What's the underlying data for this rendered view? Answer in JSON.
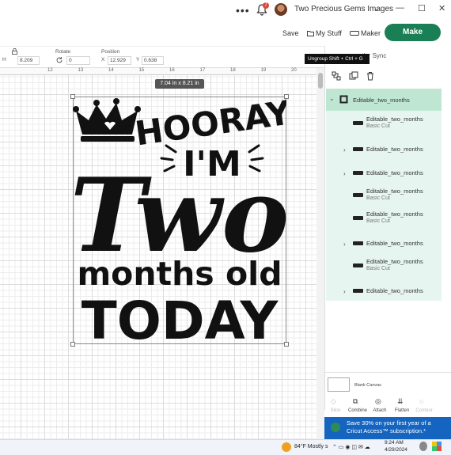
{
  "titlebar": {
    "menu_dots": "•••",
    "notif_count": "7",
    "project_name": "Two Precious Gems Images",
    "minimize": "—",
    "maximize": "☐",
    "close": "✕"
  },
  "toolbar": {
    "save_label": "Save",
    "mystuff_label": "My Stuff",
    "maker_label": "Maker",
    "make_label": "Make"
  },
  "editbar": {
    "h_label": "H",
    "h_value": "8.209",
    "rotate_label": "Rotate",
    "rotate_value": "0",
    "position_label": "Position",
    "x_label": "X",
    "x_value": "12.929",
    "y_label": "Y",
    "y_value": "0.638"
  },
  "ruler": {
    "ticks": [
      "12",
      "13",
      "14",
      "15",
      "16",
      "17",
      "18",
      "19",
      "20"
    ]
  },
  "canvas": {
    "dimension_tip": "7.04  in x 8.21  in",
    "design_lines": [
      "HOORAY",
      "I'M",
      "Two",
      "months old",
      "TODAY"
    ]
  },
  "panel": {
    "tooltip_text": "Ungroup Shift + Ctrl + G",
    "color_sync_label": "olor Sync",
    "layer_group_name": "Editable_two_months",
    "layers": [
      {
        "name": "Editable_two_months",
        "sub": "Basic Cut",
        "expandable": false
      },
      {
        "name": "Editable_two_months",
        "sub": "",
        "expandable": true
      },
      {
        "name": "Editable_two_months",
        "sub": "",
        "expandable": true
      },
      {
        "name": "Editable_two_months",
        "sub": "Basic Cut",
        "expandable": false
      },
      {
        "name": "Editable_two_months",
        "sub": "Basic Cut",
        "expandable": false
      },
      {
        "name": "Editable_two_months",
        "sub": "",
        "expandable": true
      },
      {
        "name": "Editable_two_months",
        "sub": "Basic Cut",
        "expandable": false
      },
      {
        "name": "Editable_two_months",
        "sub": "",
        "expandable": true
      }
    ],
    "blank_canvas_label": "Blank Canvas",
    "tools": [
      "Slice",
      "Combine",
      "Attach",
      "Flatten",
      "Contour"
    ],
    "promo_text": "Save 30% on your first year of a Cricut Access™ subscription.*"
  },
  "taskbar": {
    "weather": "84°F  Mostly s",
    "time": "9:24 AM",
    "date": "4/29/2024"
  },
  "colors": {
    "accent_green": "#1a7f55",
    "layer_bg": "#e6f5ef",
    "promo_blue": "#1565c0"
  }
}
